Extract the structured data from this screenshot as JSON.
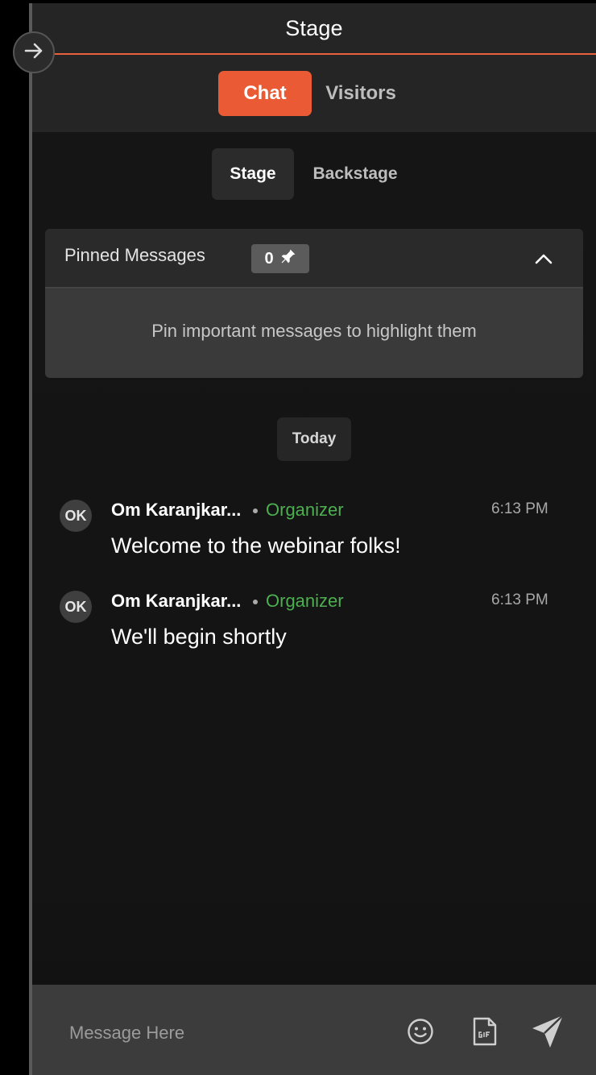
{
  "header": {
    "title": "Stage",
    "tabs": [
      {
        "label": "Chat",
        "active": true
      },
      {
        "label": "Visitors",
        "active": false
      }
    ],
    "accent_color": "#ea5b35"
  },
  "sub_tabs": [
    {
      "label": "Stage",
      "active": true
    },
    {
      "label": "Backstage",
      "active": false
    }
  ],
  "sidebar_toggle": {
    "icon": "arrow-right-icon"
  },
  "pinned": {
    "title": "Pinned Messages",
    "count": "0",
    "count_icon": "pin-icon",
    "collapse_icon": "chevron-up-icon",
    "empty_text": "Pin important messages to highlight them"
  },
  "date_separator": "Today",
  "messages": [
    {
      "avatar": "OK",
      "sender": "Om Karanjkar...",
      "role": "Organizer",
      "time": "6:13 PM",
      "text": "Welcome to the webinar folks!"
    },
    {
      "avatar": "OK",
      "sender": "Om Karanjkar...",
      "role": "Organizer",
      "time": "6:13 PM",
      "text": "We'll begin shortly"
    }
  ],
  "composer": {
    "placeholder": "Message Here",
    "icons": [
      "emoji-icon",
      "gif-icon",
      "send-icon"
    ]
  },
  "colors": {
    "role_color": "#4caf50",
    "panel_bg": "#141414",
    "header_bg": "#252525"
  }
}
